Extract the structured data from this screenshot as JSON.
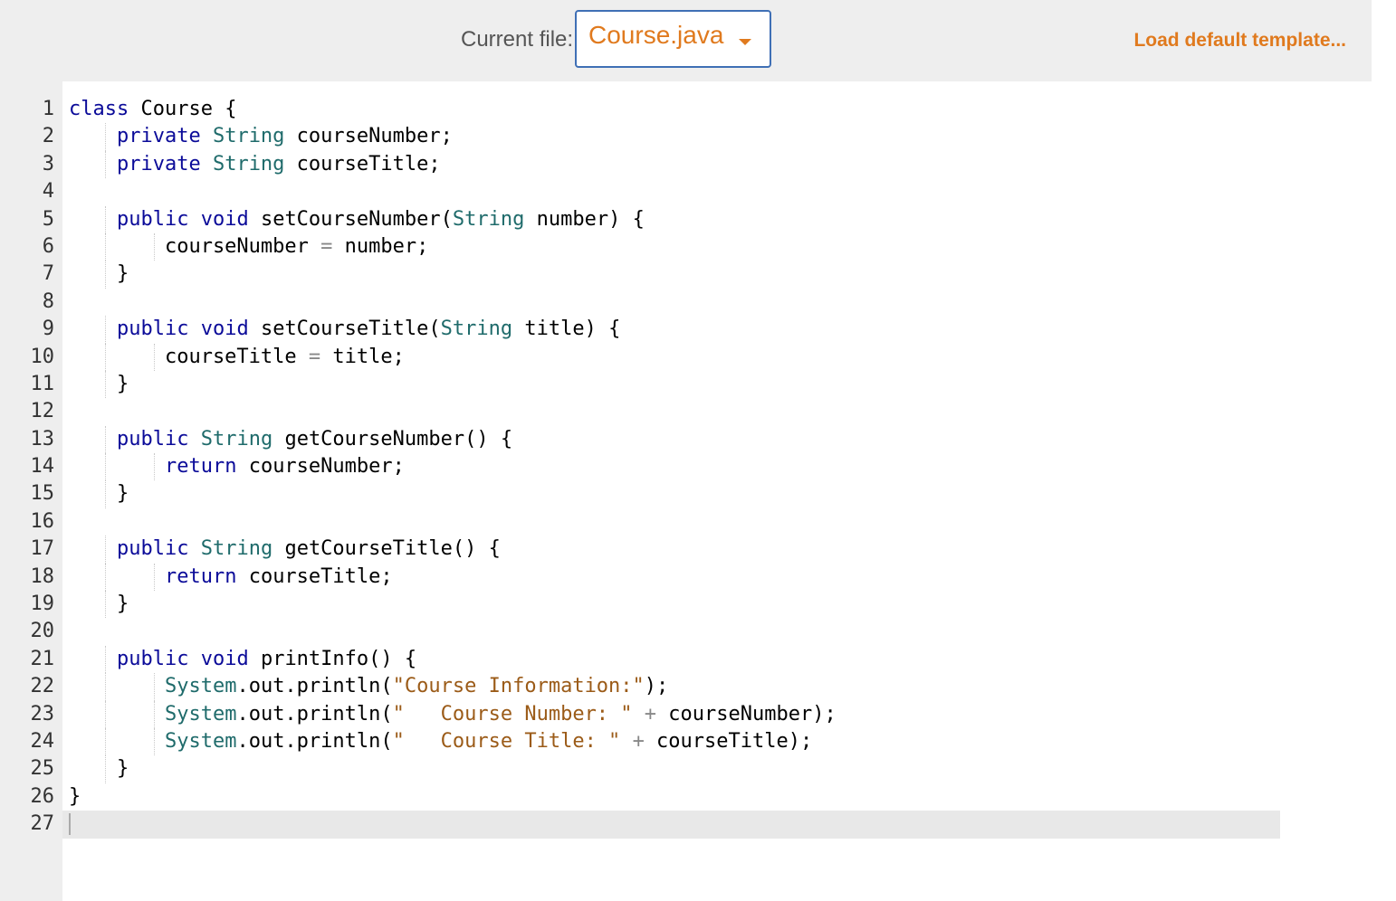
{
  "toolbar": {
    "current_file_label": "Current file:",
    "file_name": "Course.java",
    "load_template": "Load default template..."
  },
  "editor": {
    "language": "java",
    "active_line": 27,
    "lines": [
      "class Course {",
      "    private String courseNumber;",
      "    private String courseTitle;",
      "",
      "    public void setCourseNumber(String number) {",
      "        courseNumber = number;",
      "    }",
      "",
      "    public void setCourseTitle(String title) {",
      "        courseTitle = title;",
      "    }",
      "",
      "    public String getCourseNumber() {",
      "        return courseNumber;",
      "    }",
      "",
      "    public String getCourseTitle() {",
      "        return courseTitle;",
      "    }",
      "",
      "    public void printInfo() {",
      "        System.out.println(\"Course Information:\");",
      "        System.out.println(\"   Course Number: \" + courseNumber);",
      "        System.out.println(\"   Course Title: \" + courseTitle);",
      "    }",
      "}",
      ""
    ]
  },
  "colors": {
    "accent": "#e07a1e",
    "keyword": "#0b0b99",
    "type": "#1f6b6b",
    "string": "#9b5b18",
    "select_border": "#3f6fb5"
  }
}
